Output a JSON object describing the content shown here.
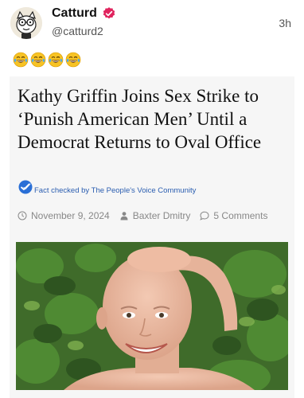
{
  "post": {
    "display_name": "Catturd",
    "handle": "@catturd2",
    "timestamp": "3h",
    "verified_icon": "verified-badge-icon",
    "text_emojis": [
      "😂",
      "😂",
      "😂",
      "😂"
    ]
  },
  "article": {
    "headline": "Kathy Griffin Joins Sex Strike to ‘Punish American Men’ Until a Democrat Returns to Oval Office",
    "fact_check_label": "Fact checked by The People's Voice Community",
    "date": "November 9, 2024",
    "author": "Baxter Dmitry",
    "comments": "5 Comments"
  },
  "colors": {
    "verified": "#e0245e",
    "link_blue": "#2a5db0",
    "meta_gray": "#888888",
    "card_bg": "#f6f6f6"
  }
}
